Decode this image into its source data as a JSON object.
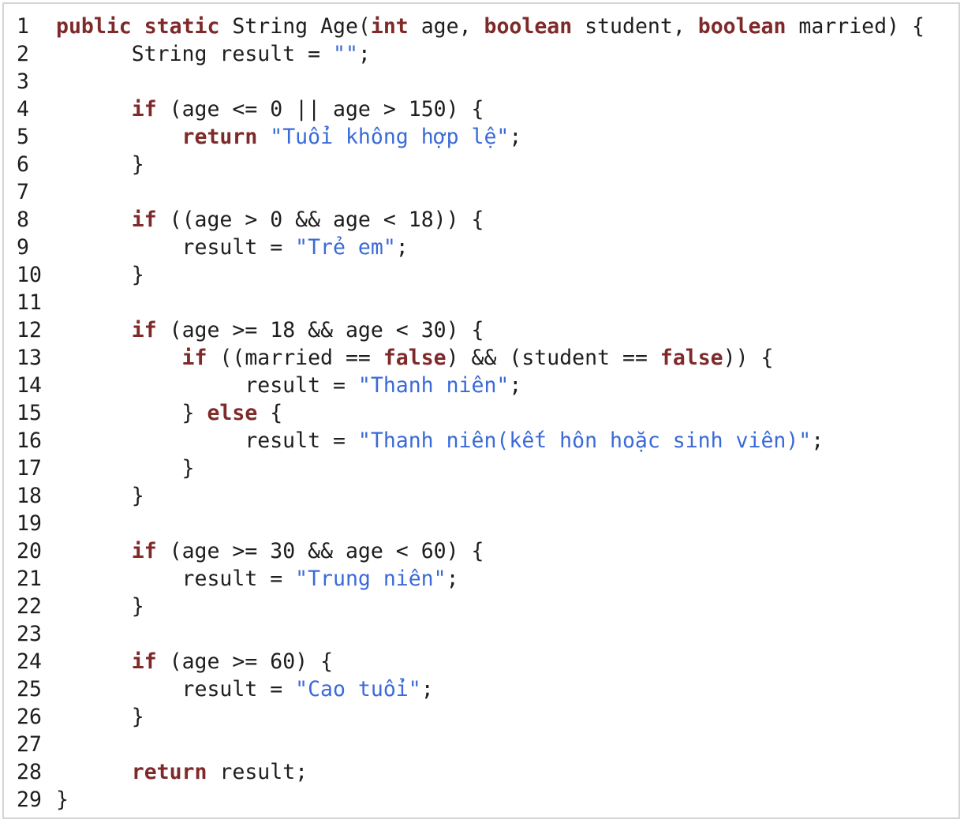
{
  "editor": {
    "language": "java",
    "colors": {
      "keyword": "#7f2a2a",
      "string": "#3a6ad8",
      "text": "#1e1e1e",
      "border": "#d4d4d4"
    },
    "lines": [
      {
        "n": "1",
        "tokens": [
          {
            "t": "kw",
            "v": "public"
          },
          {
            "t": "pl",
            "v": " "
          },
          {
            "t": "kw",
            "v": "static"
          },
          {
            "t": "pl",
            "v": " String Age("
          },
          {
            "t": "kw",
            "v": "int"
          },
          {
            "t": "pl",
            "v": " age, "
          },
          {
            "t": "kw",
            "v": "boolean"
          },
          {
            "t": "pl",
            "v": " student, "
          },
          {
            "t": "kw",
            "v": "boolean"
          },
          {
            "t": "pl",
            "v": " married) {"
          }
        ]
      },
      {
        "n": "2",
        "tokens": [
          {
            "t": "pl",
            "v": "      String result = "
          },
          {
            "t": "str",
            "v": "\"\""
          },
          {
            "t": "pl",
            "v": ";"
          }
        ]
      },
      {
        "n": "3",
        "tokens": []
      },
      {
        "n": "4",
        "tokens": [
          {
            "t": "pl",
            "v": "      "
          },
          {
            "t": "kw",
            "v": "if"
          },
          {
            "t": "pl",
            "v": " (age <= 0 || age > 150) {"
          }
        ]
      },
      {
        "n": "5",
        "tokens": [
          {
            "t": "pl",
            "v": "          "
          },
          {
            "t": "kw",
            "v": "return"
          },
          {
            "t": "pl",
            "v": " "
          },
          {
            "t": "str",
            "v": "\"Tuổi không hợp lệ\""
          },
          {
            "t": "pl",
            "v": ";"
          }
        ]
      },
      {
        "n": "6",
        "tokens": [
          {
            "t": "pl",
            "v": "      }"
          }
        ]
      },
      {
        "n": "7",
        "tokens": []
      },
      {
        "n": "8",
        "tokens": [
          {
            "t": "pl",
            "v": "      "
          },
          {
            "t": "kw",
            "v": "if"
          },
          {
            "t": "pl",
            "v": " ((age > 0 && age < 18)) {"
          }
        ]
      },
      {
        "n": "9",
        "tokens": [
          {
            "t": "pl",
            "v": "          result = "
          },
          {
            "t": "str",
            "v": "\"Trẻ em\""
          },
          {
            "t": "pl",
            "v": ";"
          }
        ]
      },
      {
        "n": "10",
        "tokens": [
          {
            "t": "pl",
            "v": "      }"
          }
        ]
      },
      {
        "n": "11",
        "tokens": []
      },
      {
        "n": "12",
        "tokens": [
          {
            "t": "pl",
            "v": "      "
          },
          {
            "t": "kw",
            "v": "if"
          },
          {
            "t": "pl",
            "v": " (age >= 18 && age < 30) {"
          }
        ]
      },
      {
        "n": "13",
        "tokens": [
          {
            "t": "pl",
            "v": "          "
          },
          {
            "t": "kw",
            "v": "if"
          },
          {
            "t": "pl",
            "v": " ((married == "
          },
          {
            "t": "kw",
            "v": "false"
          },
          {
            "t": "pl",
            "v": ") && (student == "
          },
          {
            "t": "kw",
            "v": "false"
          },
          {
            "t": "pl",
            "v": ")) {"
          }
        ]
      },
      {
        "n": "14",
        "tokens": [
          {
            "t": "pl",
            "v": "               result = "
          },
          {
            "t": "str",
            "v": "\"Thanh niên\""
          },
          {
            "t": "pl",
            "v": ";"
          }
        ]
      },
      {
        "n": "15",
        "tokens": [
          {
            "t": "pl",
            "v": "          } "
          },
          {
            "t": "kw",
            "v": "else"
          },
          {
            "t": "pl",
            "v": " {"
          }
        ]
      },
      {
        "n": "16",
        "tokens": [
          {
            "t": "pl",
            "v": "               result = "
          },
          {
            "t": "str",
            "v": "\"Thanh niên(kết hôn hoặc sinh viên)\""
          },
          {
            "t": "pl",
            "v": ";"
          }
        ]
      },
      {
        "n": "17",
        "tokens": [
          {
            "t": "pl",
            "v": "          }"
          }
        ]
      },
      {
        "n": "18",
        "tokens": [
          {
            "t": "pl",
            "v": "      }"
          }
        ]
      },
      {
        "n": "19",
        "tokens": []
      },
      {
        "n": "20",
        "tokens": [
          {
            "t": "pl",
            "v": "      "
          },
          {
            "t": "kw",
            "v": "if"
          },
          {
            "t": "pl",
            "v": " (age >= 30 && age < 60) {"
          }
        ]
      },
      {
        "n": "21",
        "tokens": [
          {
            "t": "pl",
            "v": "          result = "
          },
          {
            "t": "str",
            "v": "\"Trung niên\""
          },
          {
            "t": "pl",
            "v": ";"
          }
        ]
      },
      {
        "n": "22",
        "tokens": [
          {
            "t": "pl",
            "v": "      }"
          }
        ]
      },
      {
        "n": "23",
        "tokens": []
      },
      {
        "n": "24",
        "tokens": [
          {
            "t": "pl",
            "v": "      "
          },
          {
            "t": "kw",
            "v": "if"
          },
          {
            "t": "pl",
            "v": " (age >= 60) {"
          }
        ]
      },
      {
        "n": "25",
        "tokens": [
          {
            "t": "pl",
            "v": "          result = "
          },
          {
            "t": "str",
            "v": "\"Cao tuổi\""
          },
          {
            "t": "pl",
            "v": ";"
          }
        ]
      },
      {
        "n": "26",
        "tokens": [
          {
            "t": "pl",
            "v": "      }"
          }
        ]
      },
      {
        "n": "27",
        "tokens": []
      },
      {
        "n": "28",
        "tokens": [
          {
            "t": "pl",
            "v": "      "
          },
          {
            "t": "kw",
            "v": "return"
          },
          {
            "t": "pl",
            "v": " result;"
          }
        ]
      },
      {
        "n": "29",
        "tokens": [
          {
            "t": "pl",
            "v": "}"
          }
        ]
      }
    ]
  }
}
